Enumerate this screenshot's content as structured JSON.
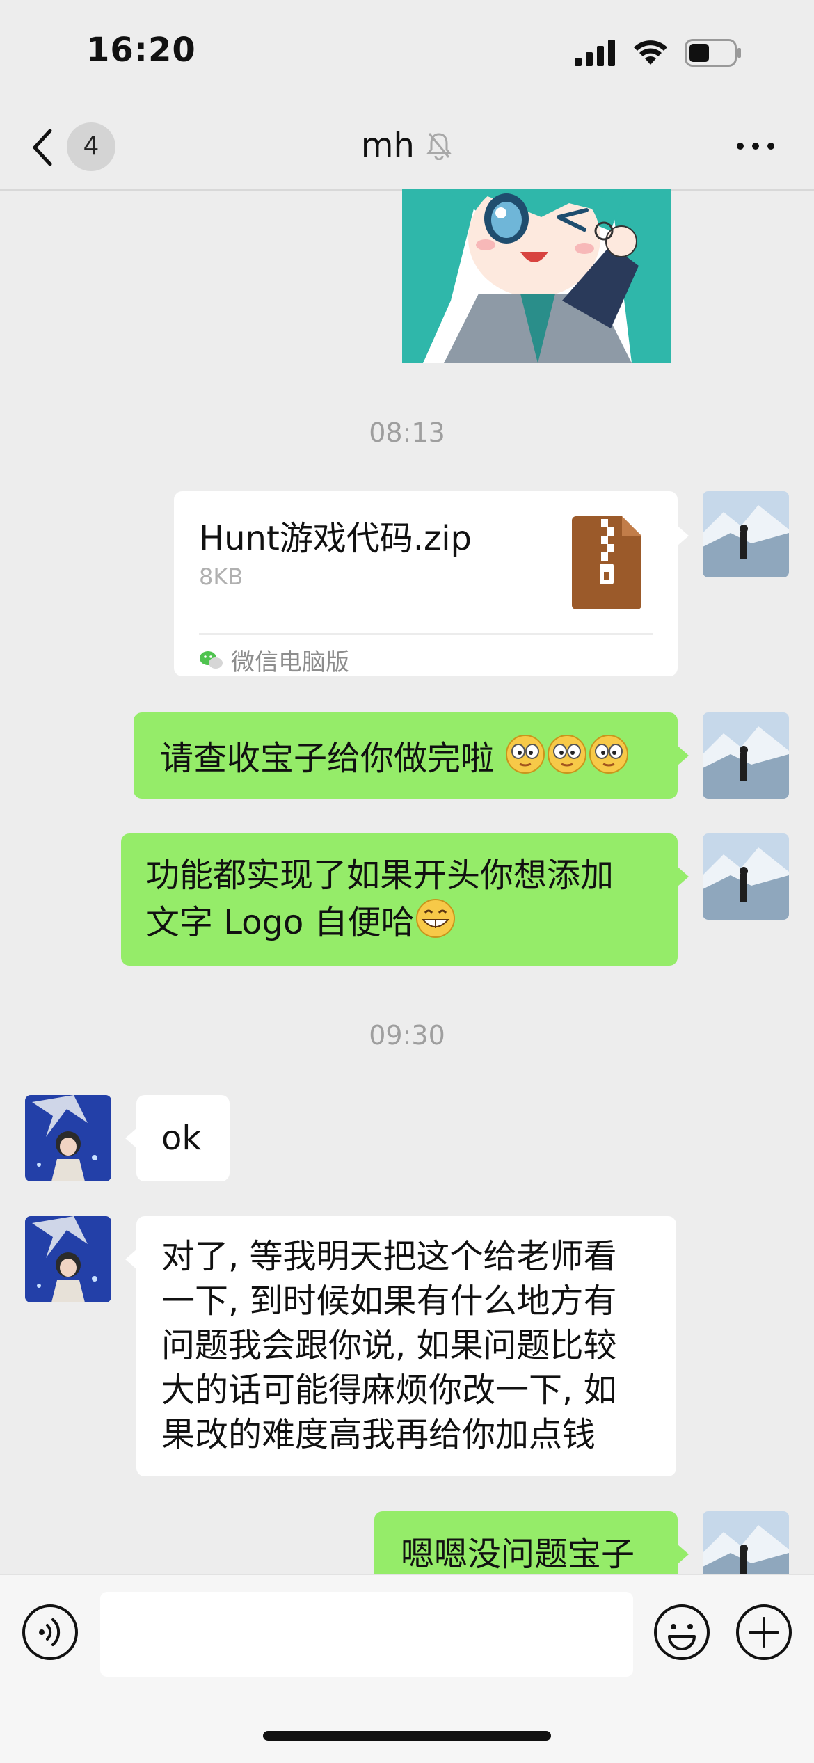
{
  "status_bar": {
    "time": "16:20",
    "icons": [
      "signal-icon",
      "wifi-icon",
      "battery-icon"
    ]
  },
  "nav": {
    "back_badge": "4",
    "title": "mh",
    "title_icon": "mute-bell-icon",
    "more_icon": "more-dots-icon"
  },
  "messages": {
    "time_1": "08:13",
    "file": {
      "name": "Hunt游戏代码.zip",
      "size": "8KB",
      "source": "微信电脑版",
      "icon": "zip-file-icon"
    },
    "msg_1": "请查收宝子给你做完啦",
    "msg_2_line1": "功能都实现了如果开头你想添加",
    "msg_2_line2": "文字 Logo 自便哈",
    "time_2": "09:30",
    "msg_3": "ok",
    "msg_4_lines": [
      "对了, 等我明天把这个给老师看",
      "一下, 到时候如果有什么地方有",
      "问题我会跟你说, 如果问题比较",
      "大的话可能得麻烦你改一下, 如",
      "果改的难度高我再给你加点钱"
    ],
    "msg_5": "嗯嗯没问题宝子"
  },
  "input_bar": {
    "input_value": "",
    "icons": [
      "voice-icon",
      "emoji-icon",
      "plus-icon"
    ]
  },
  "colors": {
    "background": "#ededed",
    "my_bubble": "#95ec69",
    "their_bubble": "#ffffff"
  }
}
